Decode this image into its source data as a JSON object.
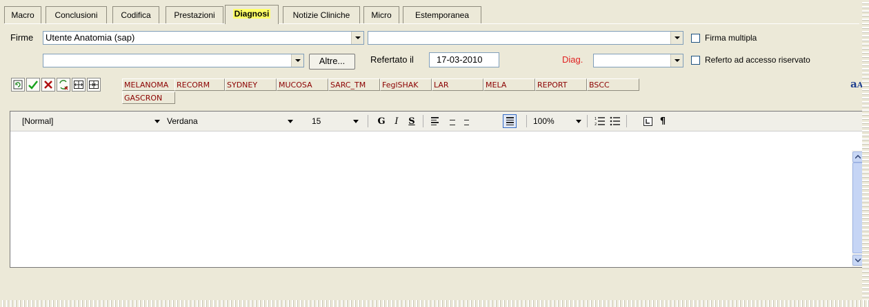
{
  "tabs": [
    {
      "label": "Macro"
    },
    {
      "label": "Conclusioni"
    },
    {
      "label": "Codifica"
    },
    {
      "label": "Prestazioni"
    },
    {
      "label": "Diagnosi"
    },
    {
      "label": "Notizie Cliniche"
    },
    {
      "label": "Micro"
    },
    {
      "label": "Estemporanea"
    }
  ],
  "active_tab": "Diagnosi",
  "firme": {
    "label": "Firme",
    "selected": "Utente Anatomia (sap)",
    "second_selected": "",
    "firma_multipla_label": "Firma multipla",
    "third_selected": "",
    "altre_label": "Altre...",
    "refertato_label": "Refertato il",
    "refertato_date": "17-03-2010",
    "diag_label": "Diag.",
    "diag_selected": "",
    "riservato_label": "Referto ad accesso riservato"
  },
  "macro_buttons": [
    "MELANOMA",
    "RECORM",
    "SYDNEY",
    "MUCOSA",
    "SARC_TM",
    "FeglSHAK",
    "LAR",
    "MELA",
    "REPORT",
    "BSCC",
    "GASCRON"
  ],
  "toolbar_icons": [
    "refresh-icon",
    "check-icon",
    "delete-icon",
    "convert-icon",
    "expand-icon",
    "collapse-icon"
  ],
  "editor": {
    "style": "[Normal]",
    "font": "Verdana",
    "size": "15",
    "bold": "G",
    "italic": "I",
    "strike": "S",
    "zoom": "100%",
    "pilcrow": "¶"
  },
  "colors": {
    "panel": "#ece9d8",
    "macro_text": "#8b0000",
    "diag_label": "#e02020",
    "active_tab_highlight": "#ffff66"
  }
}
